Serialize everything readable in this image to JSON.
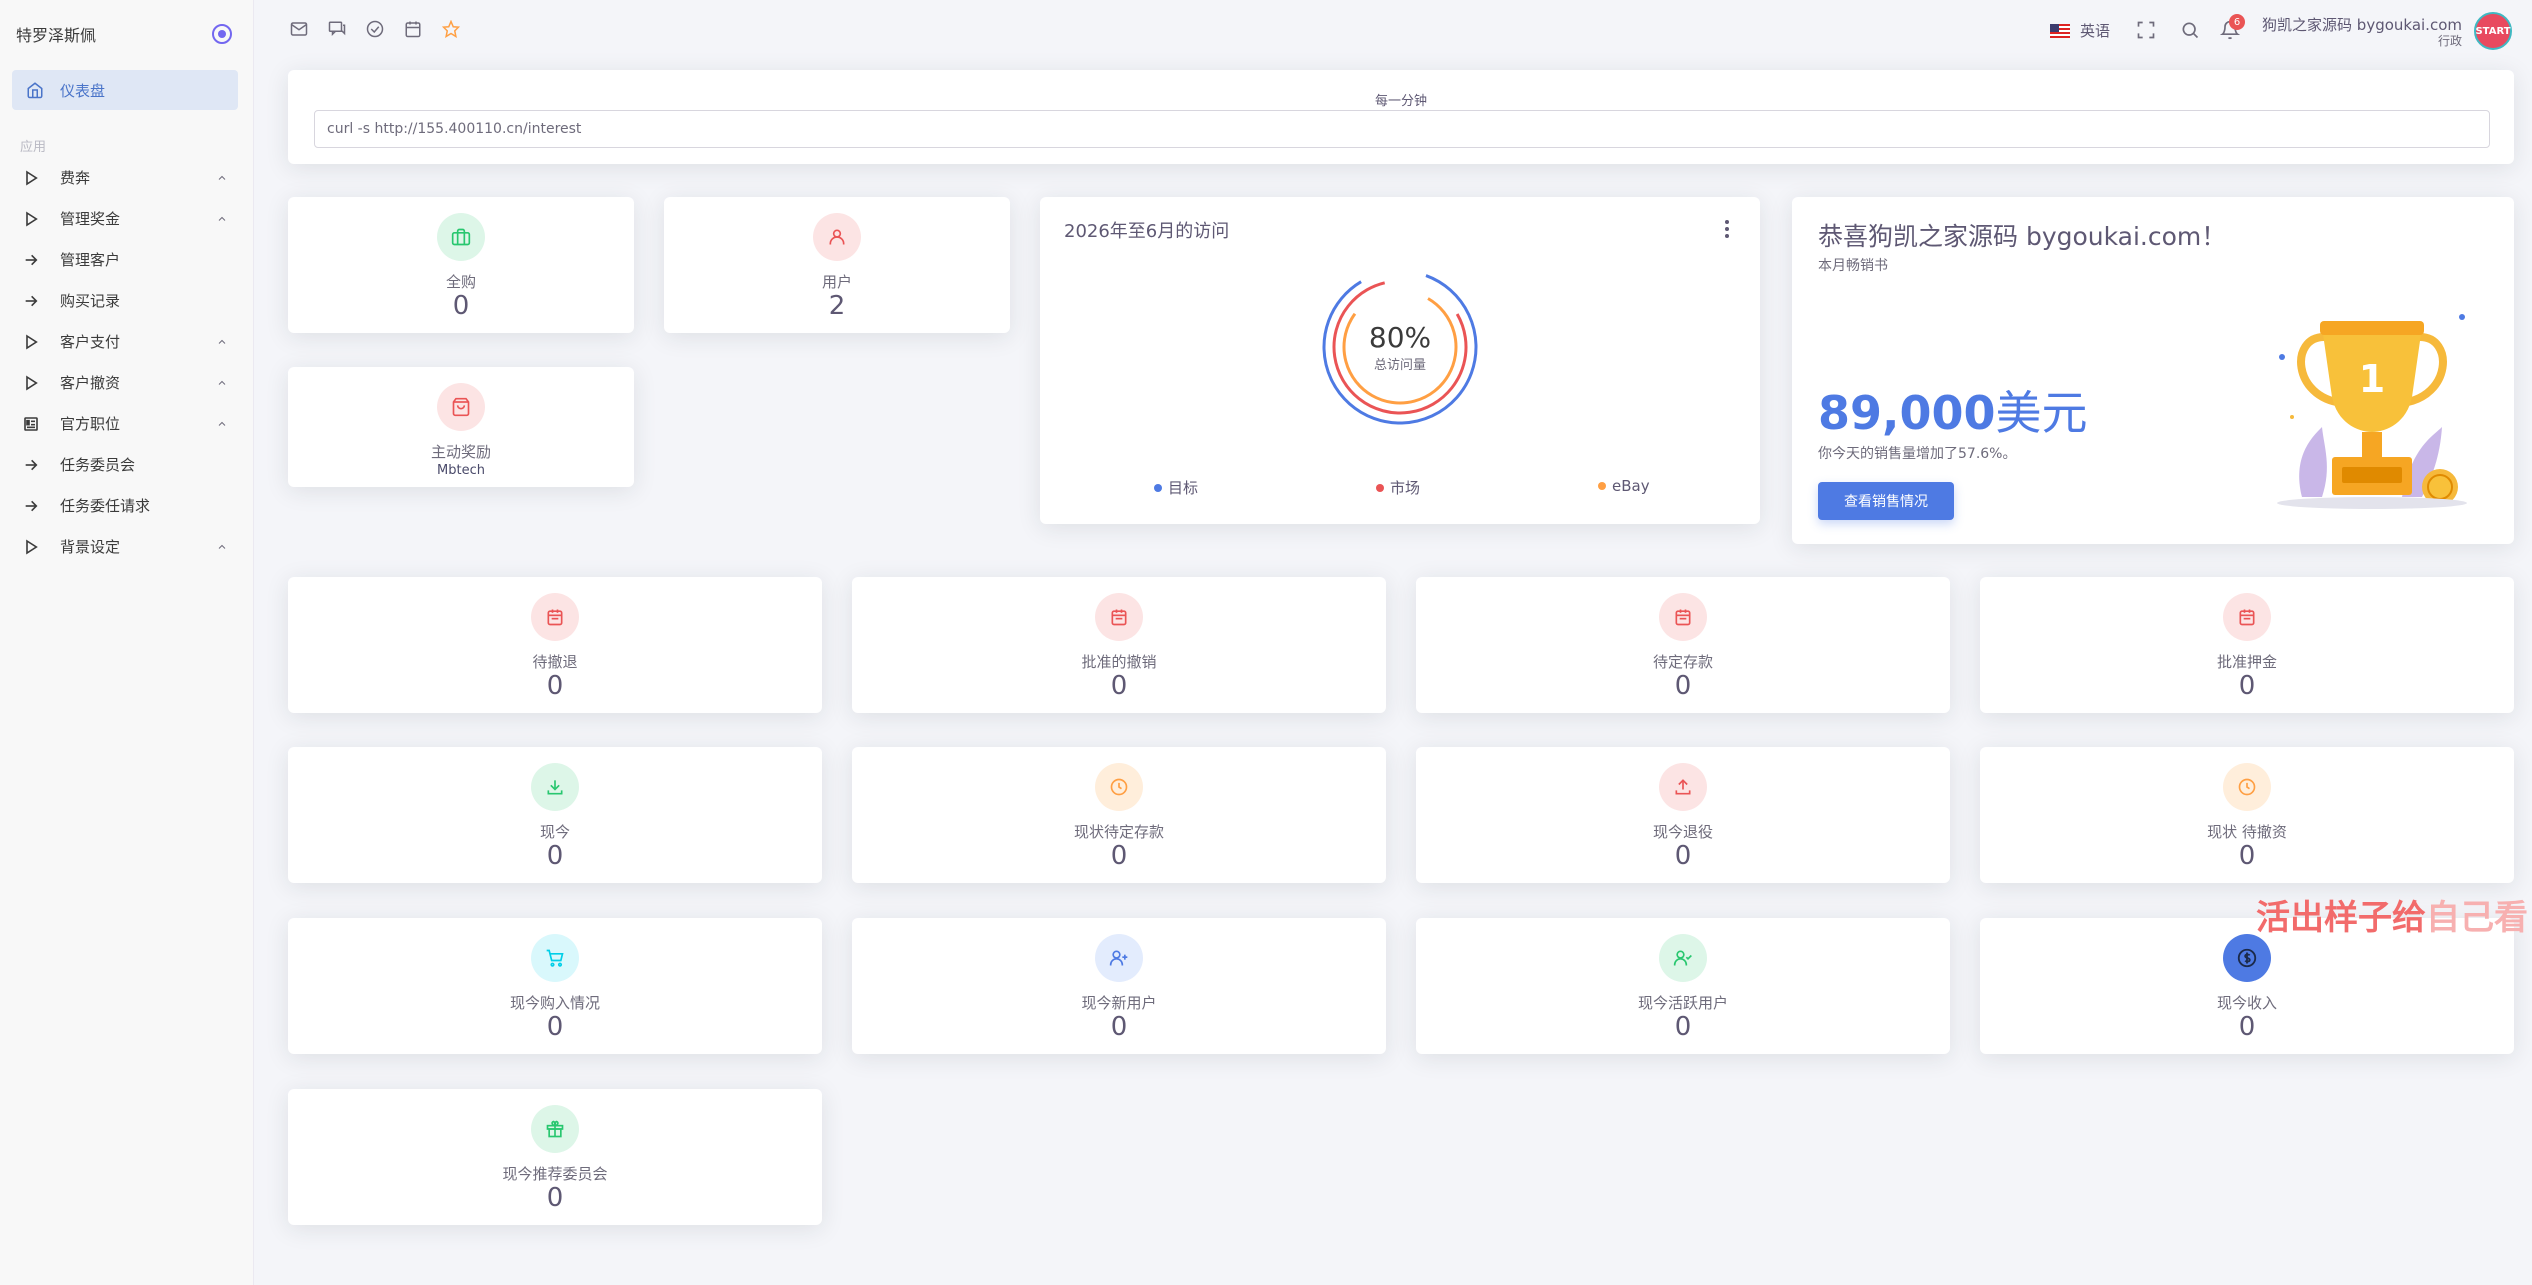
{
  "sidebar": {
    "brand": "特罗泽斯佩",
    "active_item": "仪表盘",
    "section_label": "应用",
    "items": [
      {
        "label": "费奔",
        "icon": "play-icon",
        "chevron": true
      },
      {
        "label": "管理奖金",
        "icon": "play-icon",
        "chevron": true
      },
      {
        "label": "管理客户",
        "icon": "arrow-right-icon",
        "chevron": false
      },
      {
        "label": "购买记录",
        "icon": "arrow-right-icon",
        "chevron": false
      },
      {
        "label": "客户支付",
        "icon": "play-icon",
        "chevron": true
      },
      {
        "label": "客户撤资",
        "icon": "play-icon",
        "chevron": true
      },
      {
        "label": "官方职位",
        "icon": "id-card-icon",
        "chevron": true
      },
      {
        "label": "任务委员会",
        "icon": "arrow-right-icon",
        "chevron": false
      },
      {
        "label": "任务委任请求",
        "icon": "arrow-right-icon",
        "chevron": false
      },
      {
        "label": "背景设定",
        "icon": "play-icon",
        "chevron": true
      }
    ]
  },
  "topbar": {
    "language": "英语",
    "notification_count": "6",
    "user_name": "狗凯之家源码 bygoukai.com",
    "user_role": "行政",
    "avatar_text": "START"
  },
  "cron": {
    "title": "每一分钟",
    "command": "curl -s http://155.400110.cn/interest"
  },
  "top_stats": [
    {
      "label": "全购",
      "value": "0"
    },
    {
      "label": "用户",
      "value": "2"
    },
    {
      "label": "主动奖励",
      "value": "Mbtech"
    }
  ],
  "visits": {
    "title": "2026年至6月的访问",
    "percent": "80%",
    "center_label": "总访问量",
    "legend": [
      "目标",
      "市场",
      "eBay"
    ],
    "colors": {
      "target": "#4e7ae3",
      "market": "#ea5455",
      "ebay": "#ff9f43"
    }
  },
  "congrats": {
    "title": "恭喜狗凯之家源码 bygoukai.com！",
    "subtitle": "本月畅销书",
    "amount": "89,000",
    "unit": "美元",
    "desc": "你今天的销售量增加了57.6%。",
    "button": "查看销售情况"
  },
  "stats": [
    {
      "label": "待撤退",
      "value": "0"
    },
    {
      "label": "批准的撤销",
      "value": "0"
    },
    {
      "label": "待定存款",
      "value": "0"
    },
    {
      "label": "批准押金",
      "value": "0"
    },
    {
      "label": "现今",
      "value": "0"
    },
    {
      "label": "现状待定存款",
      "value": "0"
    },
    {
      "label": "现今退役",
      "value": "0"
    },
    {
      "label": "现状 待撤资",
      "value": "0"
    },
    {
      "label": "现今购入情况",
      "value": "0"
    },
    {
      "label": "现今新用户",
      "value": "0"
    },
    {
      "label": "现今活跃用户",
      "value": "0"
    },
    {
      "label": "现今收入",
      "value": "0"
    },
    {
      "label": "现今推荐委员会",
      "value": "0"
    }
  ],
  "watermark": {
    "part1": "活出样子给",
    "part2": "自己看"
  }
}
